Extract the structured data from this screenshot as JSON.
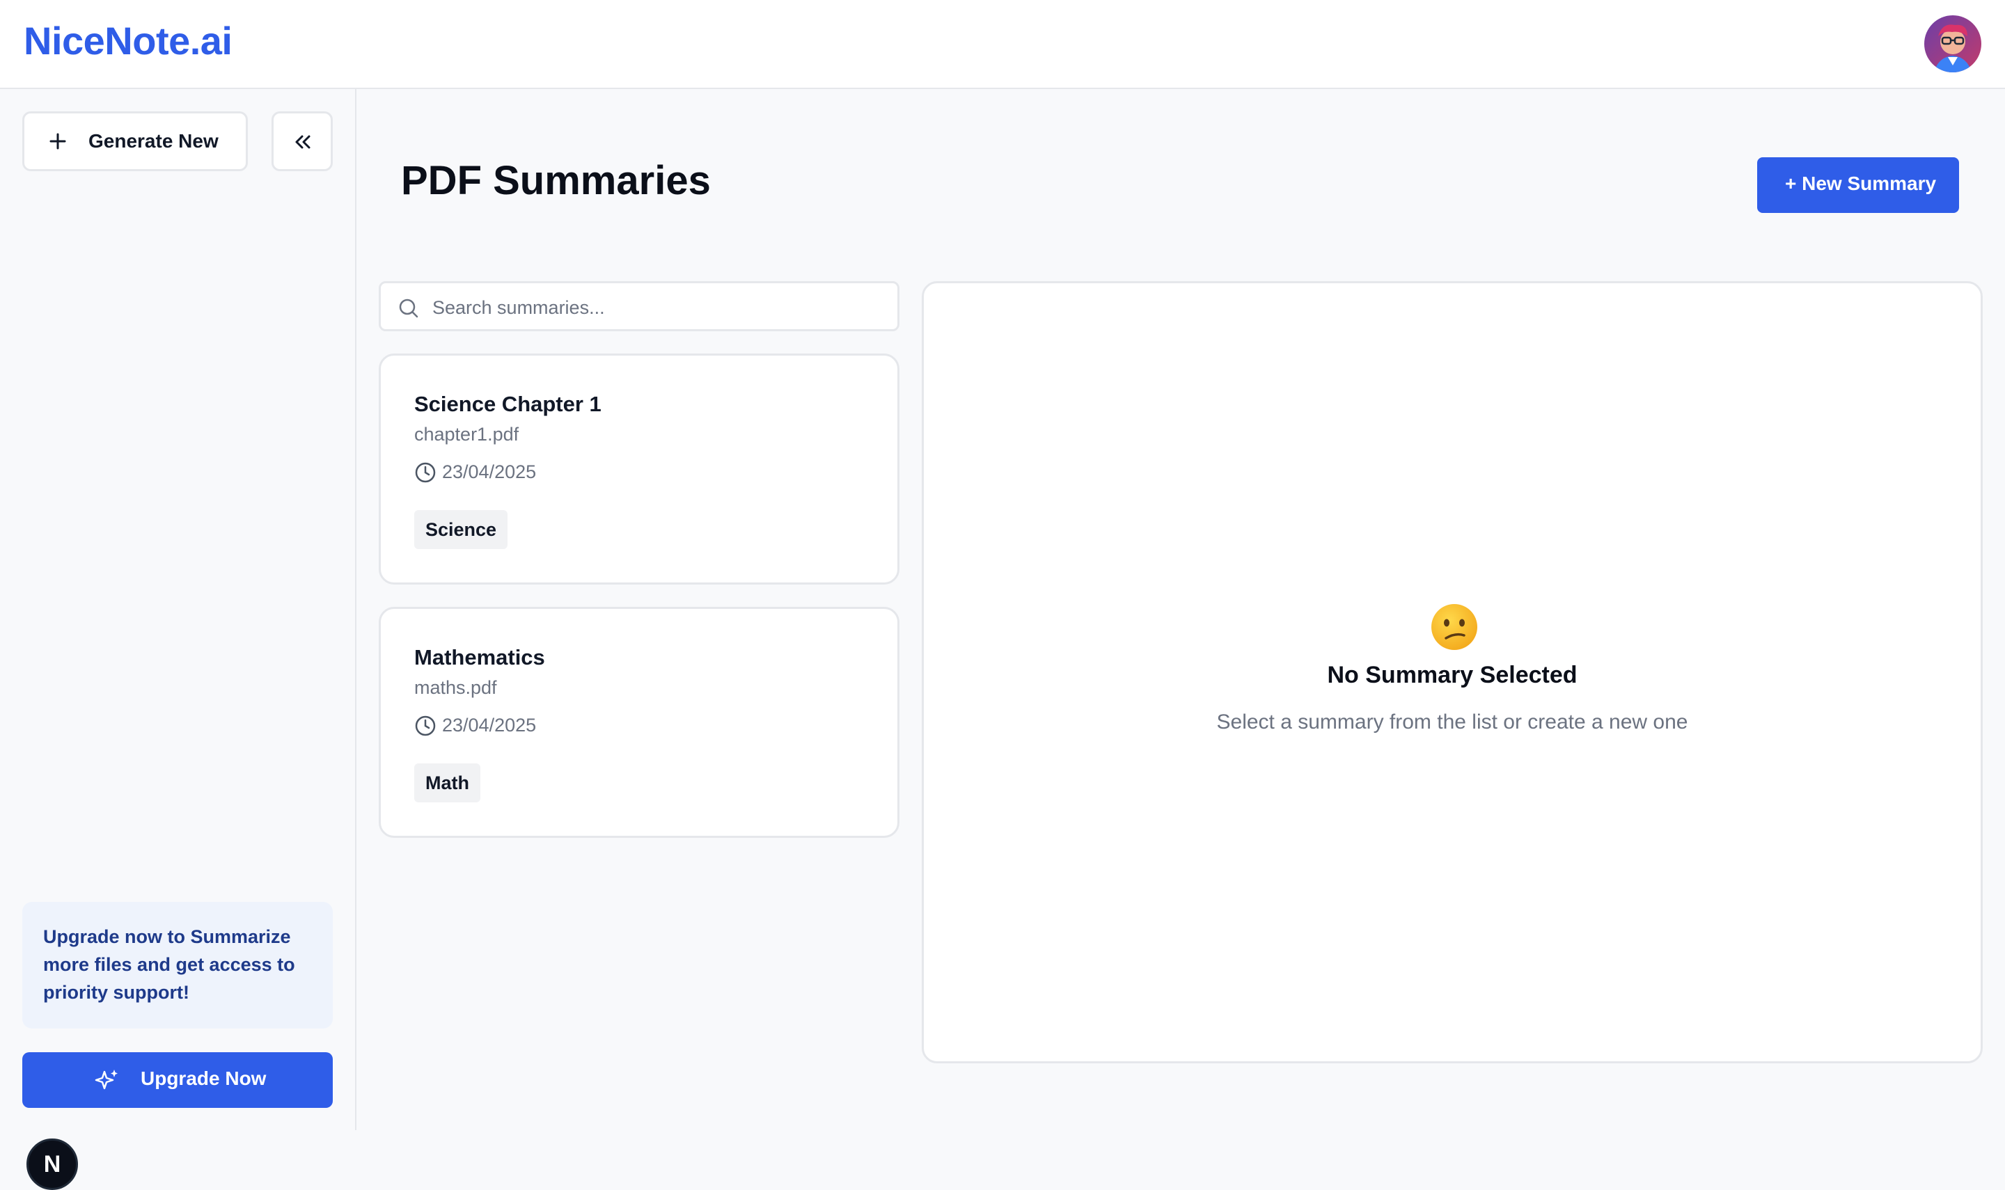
{
  "header": {
    "brand": "NiceNote.ai"
  },
  "sidebar": {
    "generate_label": "Generate New",
    "upgrade_text": "Upgrade now to Summarize more files and get access to priority support!",
    "upgrade_button": "Upgrade Now",
    "badge_letter": "N"
  },
  "main": {
    "title": "PDF Summaries",
    "new_button": "+  New Summary",
    "search_placeholder": "Search summaries...",
    "cards": [
      {
        "title": "Science Chapter 1",
        "file": "chapter1.pdf",
        "date": "23/04/2025",
        "tag": "Science"
      },
      {
        "title": "Mathematics",
        "file": "maths.pdf",
        "date": "23/04/2025",
        "tag": "Math"
      }
    ],
    "empty": {
      "title": "No Summary Selected",
      "subtitle": "Select a summary from the list or create a new one"
    }
  },
  "colors": {
    "accent": "#2f5de8",
    "upgrade_card_bg": "#eef3fc",
    "upgrade_text": "#1e3a8a"
  }
}
